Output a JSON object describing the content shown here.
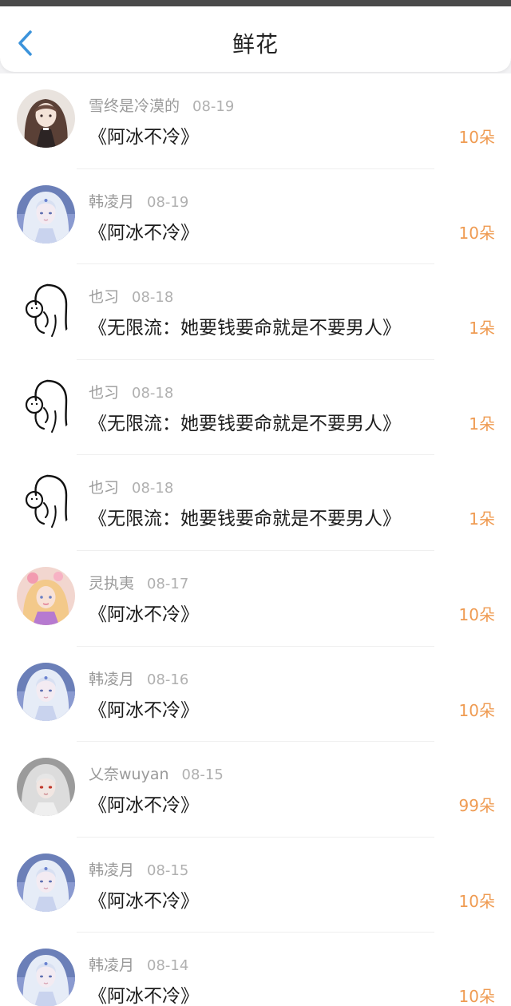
{
  "header": {
    "title": "鲜花",
    "back_icon": "chevron-left-icon",
    "accent_color": "#3b93db"
  },
  "colors": {
    "count": "#ef9b52",
    "meta": "#a7a7a7",
    "book": "#1c1c1c"
  },
  "records": [
    {
      "user": "雪终是冷漠的",
      "date": "08-19",
      "book": "《阿冰不冷》",
      "count": "10朵",
      "avatar": "avatar-dark-hair"
    },
    {
      "user": "韩凌月",
      "date": "08-19",
      "book": "《阿冰不冷》",
      "count": "10朵",
      "avatar": "avatar-silver-hair"
    },
    {
      "user": "也习",
      "date": "08-18",
      "book": "《无限流：她要钱要命就是不要男人》",
      "count": "1朵",
      "avatar": "avatar-sketch"
    },
    {
      "user": "也习",
      "date": "08-18",
      "book": "《无限流：她要钱要命就是不要男人》",
      "count": "1朵",
      "avatar": "avatar-sketch"
    },
    {
      "user": "也习",
      "date": "08-18",
      "book": "《无限流：她要钱要命就是不要男人》",
      "count": "1朵",
      "avatar": "avatar-sketch"
    },
    {
      "user": "灵执夷",
      "date": "08-17",
      "book": "《阿冰不冷》",
      "count": "10朵",
      "avatar": "avatar-pink-hair"
    },
    {
      "user": "韩凌月",
      "date": "08-16",
      "book": "《阿冰不冷》",
      "count": "10朵",
      "avatar": "avatar-silver-hair"
    },
    {
      "user": "乂奈wuyan",
      "date": "08-15",
      "book": "《阿冰不冷》",
      "count": "99朵",
      "avatar": "avatar-white-hair"
    },
    {
      "user": "韩凌月",
      "date": "08-15",
      "book": "《阿冰不冷》",
      "count": "10朵",
      "avatar": "avatar-silver-hair"
    },
    {
      "user": "韩凌月",
      "date": "08-14",
      "book": "《阿冰不冷》",
      "count": "10朵",
      "avatar": "avatar-silver-hair"
    }
  ]
}
